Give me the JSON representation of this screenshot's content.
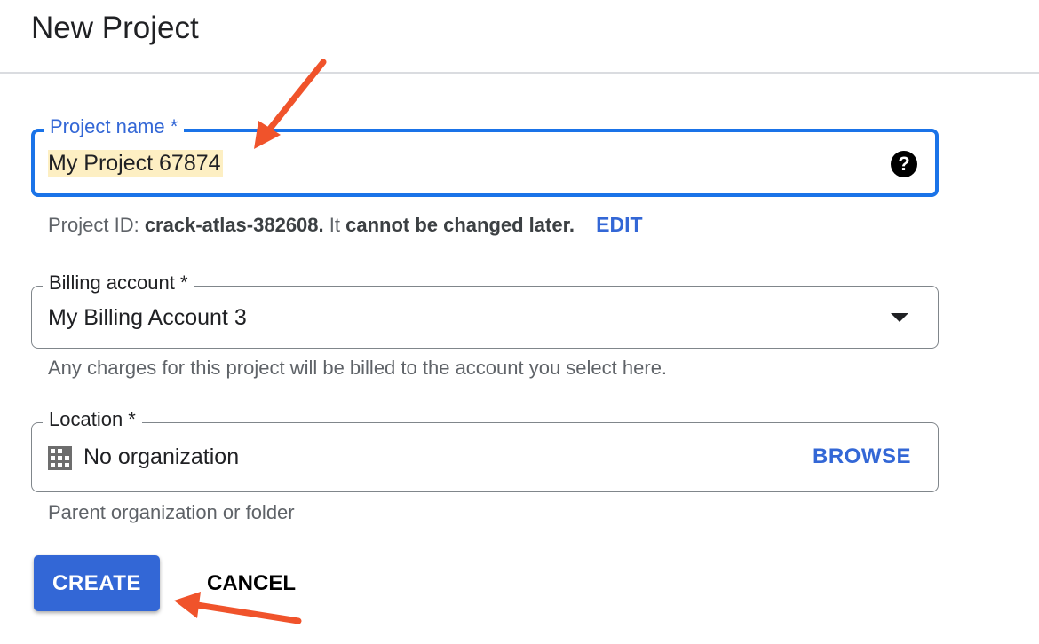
{
  "header": {
    "title": "New Project"
  },
  "project_name": {
    "label": "Project name *",
    "value": "My Project 67874",
    "help_icon": "help-circle-icon"
  },
  "project_id": {
    "prefix": "Project ID: ",
    "id": "crack-atlas-382608.",
    "middle": " It ",
    "emphasis": "cannot be changed later.",
    "edit_label": "EDIT"
  },
  "billing": {
    "label": "Billing account *",
    "selected": "My Billing Account 3",
    "hint": "Any charges for this project will be billed to the account you select here."
  },
  "location": {
    "label": "Location *",
    "value": "No organization",
    "icon": "building-icon",
    "browse_label": "BROWSE",
    "hint": "Parent organization or folder"
  },
  "actions": {
    "create_label": "CREATE",
    "cancel_label": "CANCEL"
  },
  "colors": {
    "accent": "#3367d6",
    "annotation_arrow": "#f0532b",
    "selection_highlight": "#fdefc3"
  }
}
